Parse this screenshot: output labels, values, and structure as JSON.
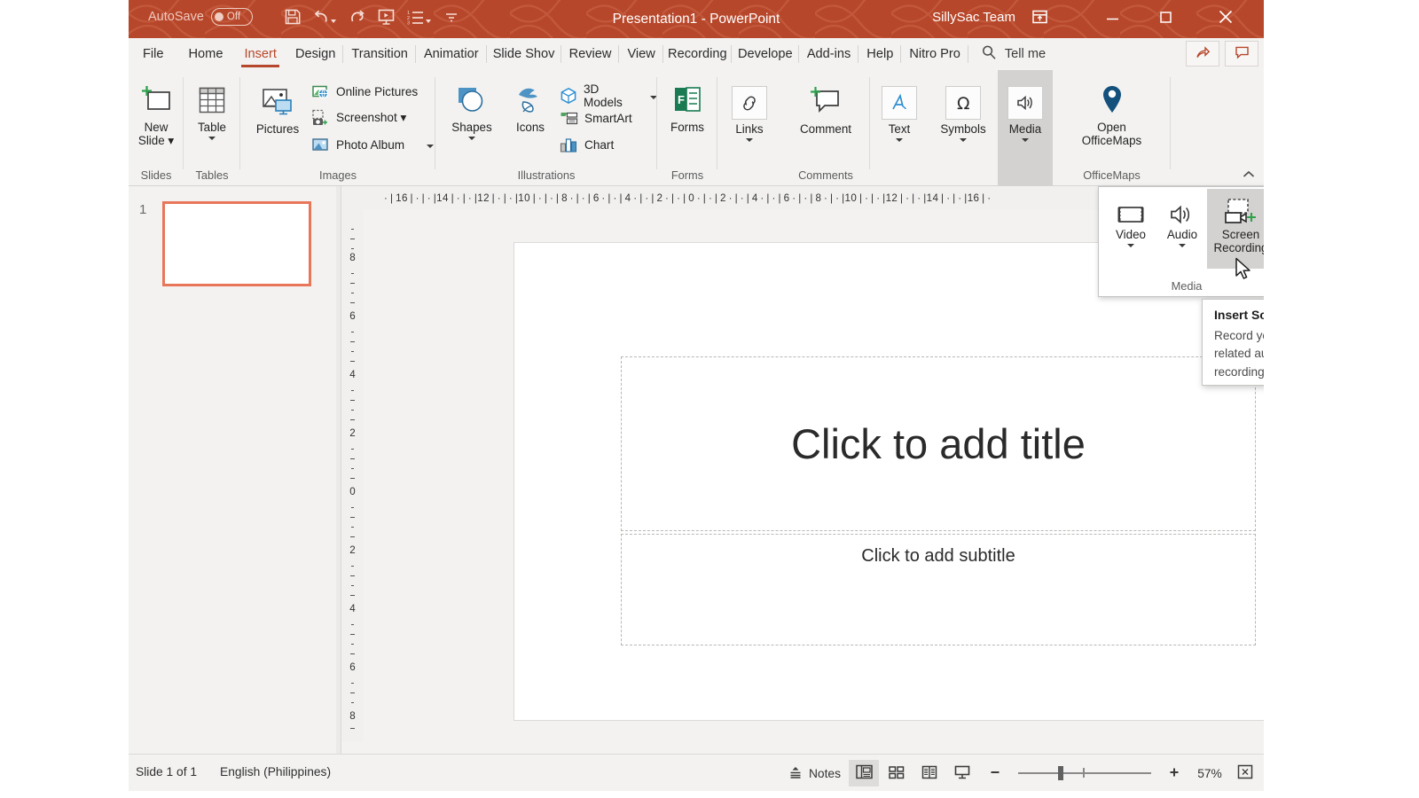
{
  "titlebar": {
    "autosave_label": "AutoSave",
    "autosave_state": "Off",
    "document_title": "Presentation1  -  PowerPoint",
    "team_name": "SillySac Team",
    "accent_color": "#b7472a",
    "qat": [
      {
        "name": "save-icon",
        "label": "Save"
      },
      {
        "name": "undo-icon",
        "label": "Undo"
      },
      {
        "name": "redo-icon",
        "label": "Redo"
      },
      {
        "name": "start-from-beginning-icon",
        "label": "Start From Beginning"
      },
      {
        "name": "list-icon",
        "label": "Custom Quick Access"
      },
      {
        "name": "customize-qat-icon",
        "label": "Customize Quick Access Toolbar"
      }
    ],
    "ribbon_display_icon": "ribbon-display-options-icon",
    "minimize": "–",
    "maximize": "□",
    "close": "✕"
  },
  "tabs": [
    {
      "label": "File",
      "active": false
    },
    {
      "label": "Home",
      "active": false
    },
    {
      "label": "Insert",
      "active": true
    },
    {
      "label": "Design",
      "active": false
    },
    {
      "label": "Transition",
      "active": false
    },
    {
      "label": "Animatior",
      "active": false
    },
    {
      "label": "Slide Shoᴠ",
      "active": false
    },
    {
      "label": "Review",
      "active": false
    },
    {
      "label": "View",
      "active": false
    },
    {
      "label": "Recording",
      "active": false
    },
    {
      "label": "Develope",
      "active": false
    },
    {
      "label": "Add-ins",
      "active": false
    },
    {
      "label": "Help",
      "active": false
    },
    {
      "label": "Nitro Pro",
      "active": false
    }
  ],
  "tellme": {
    "icon": "search-icon",
    "label": "Tell me"
  },
  "tab_right_buttons": [
    {
      "name": "share-button",
      "icon": "share-icon"
    },
    {
      "name": "comments-button",
      "icon": "comment-icon"
    }
  ],
  "ribbon": {
    "groups": [
      {
        "label": "Slides"
      },
      {
        "label": "Tables"
      },
      {
        "label": "Images"
      },
      {
        "label": "Illustrations"
      },
      {
        "label": "Forms"
      },
      {
        "label": "Comments"
      },
      {
        "label": "Media"
      },
      {
        "label": "OfficeMaps"
      }
    ],
    "new_slide": {
      "line1": "New",
      "line2": "Slide ▾"
    },
    "table": {
      "label": "Table"
    },
    "pictures": {
      "label": "Pictures"
    },
    "online_pictures": {
      "label": "Online Pictures"
    },
    "screenshot": {
      "label": "Screenshot ▾"
    },
    "photo_album": {
      "label": "Photo Album"
    },
    "shapes": {
      "label": "Shapes"
    },
    "icons": {
      "label": "Icons"
    },
    "models3d": {
      "label": "3D Models"
    },
    "smartart": {
      "label": "SmartArt"
    },
    "chart": {
      "label": "Chart"
    },
    "forms": {
      "label": "Forms"
    },
    "links": {
      "label": "Links"
    },
    "comment": {
      "label": "Comment"
    },
    "text": {
      "label": "Text"
    },
    "symbols": {
      "label": "Symbols"
    },
    "media": {
      "label": "Media"
    },
    "open_officemaps": {
      "line1": "Open",
      "line2": "OfficeMaps"
    },
    "collapse_ribbon": "⌃"
  },
  "media_menu": {
    "group_label": "Media",
    "items": [
      {
        "label": "Video",
        "has_caret": true,
        "selected": false,
        "icon": "video-icon"
      },
      {
        "label": "Audio",
        "has_caret": true,
        "selected": false,
        "icon": "audio-icon"
      },
      {
        "label": "Screen\nRecording",
        "label_line1": "Screen",
        "label_line2": "Recording",
        "has_caret": false,
        "selected": true,
        "icon": "screen-recording-icon"
      }
    ]
  },
  "tooltip": {
    "title": "Insert Screen Recording",
    "body_line1": "Record your computer screen",
    "body_line2": "related audio before inserting",
    "body_line3": "recording onto your slide."
  },
  "ruler": {
    "horizontal_ticks": [
      "16",
      "14",
      "12",
      "10",
      "8",
      "6",
      "4",
      "2",
      "0",
      "2",
      "4",
      "6",
      "8",
      "10",
      "12",
      "14",
      "16"
    ],
    "vertical_ticks": [
      "8",
      "6",
      "4",
      "2",
      "0",
      "2",
      "4",
      "6",
      "8"
    ]
  },
  "slide_pane": {
    "slide_number": "1"
  },
  "slide": {
    "title_placeholder": "Click to add title",
    "subtitle_placeholder": "Click to add subtitle"
  },
  "statusbar": {
    "slide_count": "Slide 1 of 1",
    "language": "English (Philippines)",
    "notes_label": "Notes",
    "zoom_percent": "57%",
    "view_buttons": [
      {
        "name": "normal-view-button",
        "icon": "normal-view-icon",
        "active": true
      },
      {
        "name": "slide-sorter-button",
        "icon": "slide-sorter-icon",
        "active": false
      },
      {
        "name": "reading-view-button",
        "icon": "reading-view-icon",
        "active": false
      },
      {
        "name": "slide-show-button",
        "icon": "slide-show-icon",
        "active": false
      }
    ],
    "zoom_out": "–",
    "zoom_in": "+",
    "fit_label": "fit-to-window-icon"
  }
}
